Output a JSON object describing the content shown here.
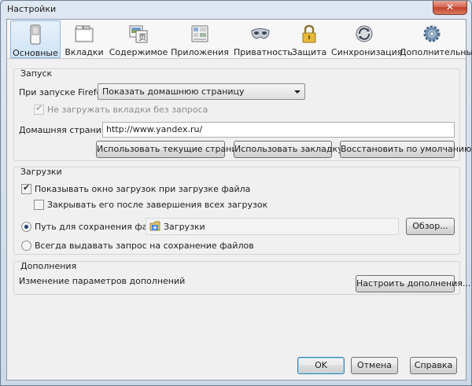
{
  "window": {
    "title": "Настройки",
    "close_label": "✕"
  },
  "tabs": [
    {
      "label": "Основные",
      "icon": "general-switch-icon",
      "selected": true
    },
    {
      "label": "Вкладки",
      "icon": "tabs-icon"
    },
    {
      "label": "Содержимое",
      "icon": "content-icon"
    },
    {
      "label": "Приложения",
      "icon": "applications-icon"
    },
    {
      "label": "Приватность",
      "icon": "privacy-mask-icon"
    },
    {
      "label": "Защита",
      "icon": "security-lock-icon"
    },
    {
      "label": "Синхронизация",
      "icon": "sync-icon"
    },
    {
      "label": "Дополнительные",
      "icon": "advanced-gear-icon"
    }
  ],
  "startup": {
    "group_title": "Запуск",
    "when_starts_label": "При запуске Firefox:",
    "when_starts_value": "Показать домашнюю страницу",
    "no_load_tabs_label": "Не загружать вкладки без запроса",
    "no_load_tabs_checked": true,
    "homepage_label": "Домашняя страница:",
    "homepage_value": "http://www.yandex.ru/",
    "use_current_button": "Использовать текущие страницы",
    "use_bookmark_button": "Использовать закладку...",
    "restore_default_button": "Восстановить по умолчанию"
  },
  "downloads": {
    "group_title": "Загрузки",
    "show_window_label": "Показывать окно загрузок при загрузке файла",
    "show_window_checked": true,
    "close_when_done_label": "Закрывать его после завершения всех загрузок",
    "close_when_done_checked": false,
    "save_path_label": "Путь для сохранения файлов",
    "save_path_value": "Загрузки",
    "browse_button": "Обзор...",
    "always_ask_label": "Всегда выдавать запрос на сохранение файлов",
    "selected_option": "save_path"
  },
  "addons": {
    "group_title": "Дополнения",
    "description": "Изменение параметров дополнений",
    "manage_button": "Настроить дополнения..."
  },
  "footer": {
    "ok_button": "OK",
    "cancel_button": "Отмена",
    "help_button": "Справка"
  },
  "colors": {
    "selected_tab_bg": "#cfe3f7",
    "dialog_bg": "#f0f0f0",
    "default_button_border": "#3c7fb1"
  }
}
